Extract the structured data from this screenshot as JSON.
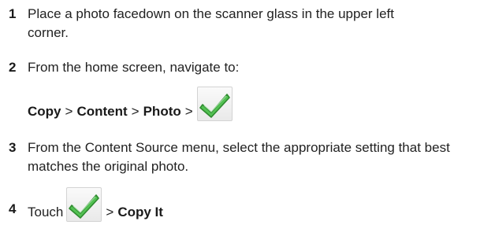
{
  "steps": [
    {
      "number": "1",
      "text": "Place a photo facedown on the scanner glass in the upper left corner."
    },
    {
      "number": "2",
      "text": "From the home screen, navigate to:",
      "path": {
        "copy": "Copy",
        "content": "Content",
        "photo": "Photo",
        "separator": ">"
      },
      "icon": "checkmark-icon"
    },
    {
      "number": "3",
      "text": "From the Content Source menu, select the appropriate setting that best matches the original photo."
    },
    {
      "number": "4",
      "prefix": "Touch",
      "separator": ">",
      "action": "Copy It",
      "icon": "checkmark-icon"
    }
  ],
  "colors": {
    "check_fill": "#52c152",
    "check_stroke": "#2f8a2f",
    "text": "#222222"
  }
}
